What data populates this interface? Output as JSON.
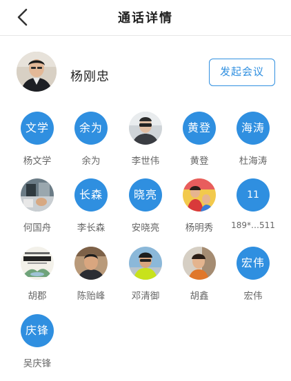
{
  "header": {
    "title": "通话详情",
    "back_icon": "chevron-left-icon"
  },
  "host": {
    "name": "杨刚忠",
    "meeting_button": "发起会议"
  },
  "members": [
    {
      "avatar_text": "文学",
      "label": "杨文学",
      "avatar_type": "text"
    },
    {
      "avatar_text": "余为",
      "label": "余为",
      "avatar_type": "text"
    },
    {
      "avatar_text": "",
      "label": "李世伟",
      "avatar_type": "photo"
    },
    {
      "avatar_text": "黄登",
      "label": "黄登",
      "avatar_type": "text"
    },
    {
      "avatar_text": "海涛",
      "label": "杜海涛",
      "avatar_type": "text"
    },
    {
      "avatar_text": "",
      "label": "何国舟",
      "avatar_type": "photo"
    },
    {
      "avatar_text": "长森",
      "label": "李长森",
      "avatar_type": "text"
    },
    {
      "avatar_text": "晓亮",
      "label": "安晓亮",
      "avatar_type": "text"
    },
    {
      "avatar_text": "",
      "label": "杨明秀",
      "avatar_type": "photo"
    },
    {
      "avatar_text": "11",
      "label": "189*…511",
      "avatar_type": "text"
    },
    {
      "avatar_text": "",
      "label": "胡郡",
      "avatar_type": "photo"
    },
    {
      "avatar_text": "",
      "label": "陈贻峰",
      "avatar_type": "photo"
    },
    {
      "avatar_text": "",
      "label": "邓清御",
      "avatar_type": "photo"
    },
    {
      "avatar_text": "",
      "label": "胡鑫",
      "avatar_type": "photo"
    },
    {
      "avatar_text": "宏伟",
      "label": "宏伟",
      "avatar_type": "text"
    },
    {
      "avatar_text": "庆锋",
      "label": "吴庆锋",
      "avatar_type": "text"
    }
  ],
  "colors": {
    "accent": "#2f8fe0",
    "label_gray": "#666666",
    "divider": "#e6e6e6"
  }
}
